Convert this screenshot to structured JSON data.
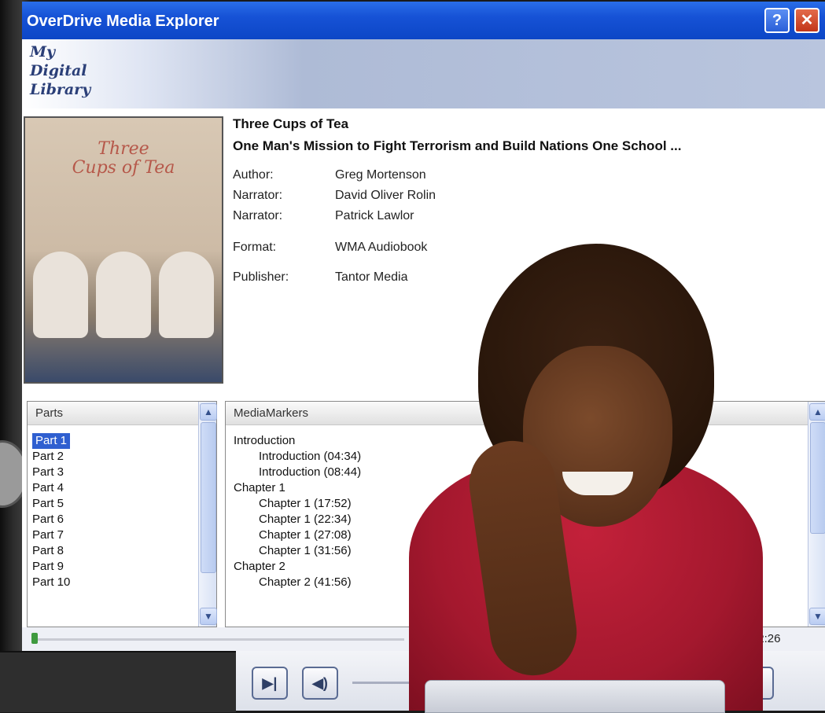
{
  "window": {
    "title": "OverDrive Media Explorer",
    "help_glyph": "?",
    "close_glyph": "✕"
  },
  "banner": {
    "logo_lines": [
      "My",
      "Digital",
      "Library"
    ]
  },
  "book": {
    "title": "Three Cups of Tea",
    "subtitle": "One Man's Mission to Fight Terrorism and Build Nations   One School ...",
    "cover_text": [
      "Three",
      "Cups of Tea"
    ],
    "meta": [
      {
        "label": "Author:",
        "value": "Greg Mortenson"
      },
      {
        "label": "Narrator:",
        "value": "David Oliver Rolin"
      },
      {
        "label": "Narrator:",
        "value": "Patrick Lawlor"
      },
      {
        "label": "Format:",
        "value": "WMA Audiobook"
      },
      {
        "label": "Publisher:",
        "value": "Tantor Media"
      }
    ]
  },
  "parts": {
    "header": "Parts",
    "items": [
      "Part 1",
      "Part 2",
      "Part 3",
      "Part 4",
      "Part 5",
      "Part 6",
      "Part 7",
      "Part 8",
      "Part 9",
      "Part 10"
    ],
    "selected": "Part 1"
  },
  "markers": {
    "header": "MediaMarkers",
    "items": [
      {
        "text": "Introduction",
        "level": 1
      },
      {
        "text": "Introduction (04:34)",
        "level": 2
      },
      {
        "text": "Introduction (08:44)",
        "level": 2
      },
      {
        "text": "Chapter 1",
        "level": 1
      },
      {
        "text": "Chapter 1 (17:52)",
        "level": 2
      },
      {
        "text": "Chapter 1 (22:34)",
        "level": 2
      },
      {
        "text": "Chapter 1 (27:08)",
        "level": 2
      },
      {
        "text": "Chapter 1 (31:56)",
        "level": 2
      },
      {
        "text": "Chapter 2",
        "level": 1
      },
      {
        "text": "Chapter 2 (41:56)",
        "level": 2
      }
    ]
  },
  "player": {
    "time": "00:05 / 01:12:26",
    "next_glyph": "▶|",
    "volume_glyph": "◀)",
    "help_glyph": "?"
  },
  "colors": {
    "titlebar": "#1652d6",
    "selection": "#2f5fd0",
    "shirt": "#a4182e"
  }
}
